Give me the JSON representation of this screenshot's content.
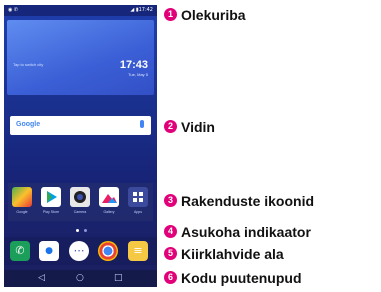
{
  "status_bar": {
    "left_icons": "◉ ✆",
    "right_info": "◢ ▮17:42"
  },
  "clock_widget": {
    "tap_text": "Tap to switch city",
    "time": "17:43",
    "date": "Tue, May 5"
  },
  "search_widget": {
    "logo": "Google"
  },
  "apps": [
    {
      "label": "Google"
    },
    {
      "label": "Play Store"
    },
    {
      "label": "Camera"
    },
    {
      "label": "Gallery"
    },
    {
      "label": "Apps"
    }
  ],
  "dock": {
    "phone_icon": "✆",
    "contacts_icon": "●",
    "apps_icon": "⋯",
    "chrome_icon": "◉",
    "messages_icon": "≡"
  },
  "navbar": {
    "back": "◁",
    "home": "○",
    "recents": "□"
  },
  "callouts": [
    {
      "num": "1",
      "label": "Olekuriba"
    },
    {
      "num": "2",
      "label": "Vidin"
    },
    {
      "num": "3",
      "label": "Rakenduste ikoonid"
    },
    {
      "num": "4",
      "label": "Asukoha indikaator"
    },
    {
      "num": "5",
      "label": "Kiirklahvide ala"
    },
    {
      "num": "6",
      "label": "Kodu puutenupud"
    }
  ]
}
